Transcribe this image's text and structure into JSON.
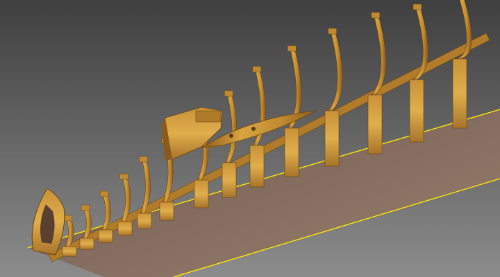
{
  "scene": {
    "subject": "ship-hull-frame-model",
    "colors": {
      "background_top": "#3f3f3f",
      "background_bottom": "#8c8c8c",
      "building_board": "#8a7060",
      "board_edge": "#ffe800",
      "wood_light": "#d9a440",
      "wood_mid": "#b8842c",
      "wood_dark": "#7a4e16"
    }
  }
}
